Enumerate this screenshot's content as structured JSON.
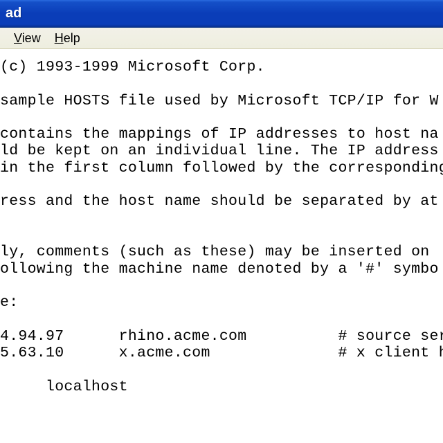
{
  "titlebar": {
    "title": "ad"
  },
  "menubar": {
    "view": "View",
    "help": "Help"
  },
  "content": {
    "lines": [
      "(c) 1993-1999 Microsoft Corp.",
      "",
      "sample HOSTS file used by Microsoft TCP/IP for W",
      "",
      "contains the mappings of IP addresses to host na",
      "ld be kept on an individual line. The IP address",
      "in the first column followed by the corresponding",
      "",
      "ress and the host name should be separated by at",
      "",
      "",
      "ly, comments (such as these) may be inserted on ",
      "ollowing the machine name denoted by a '#' symbo",
      "",
      "e:",
      "",
      "4.94.97      rhino.acme.com          # source ser",
      "5.63.10      x.acme.com              # x client h",
      "",
      "     localhost"
    ]
  }
}
